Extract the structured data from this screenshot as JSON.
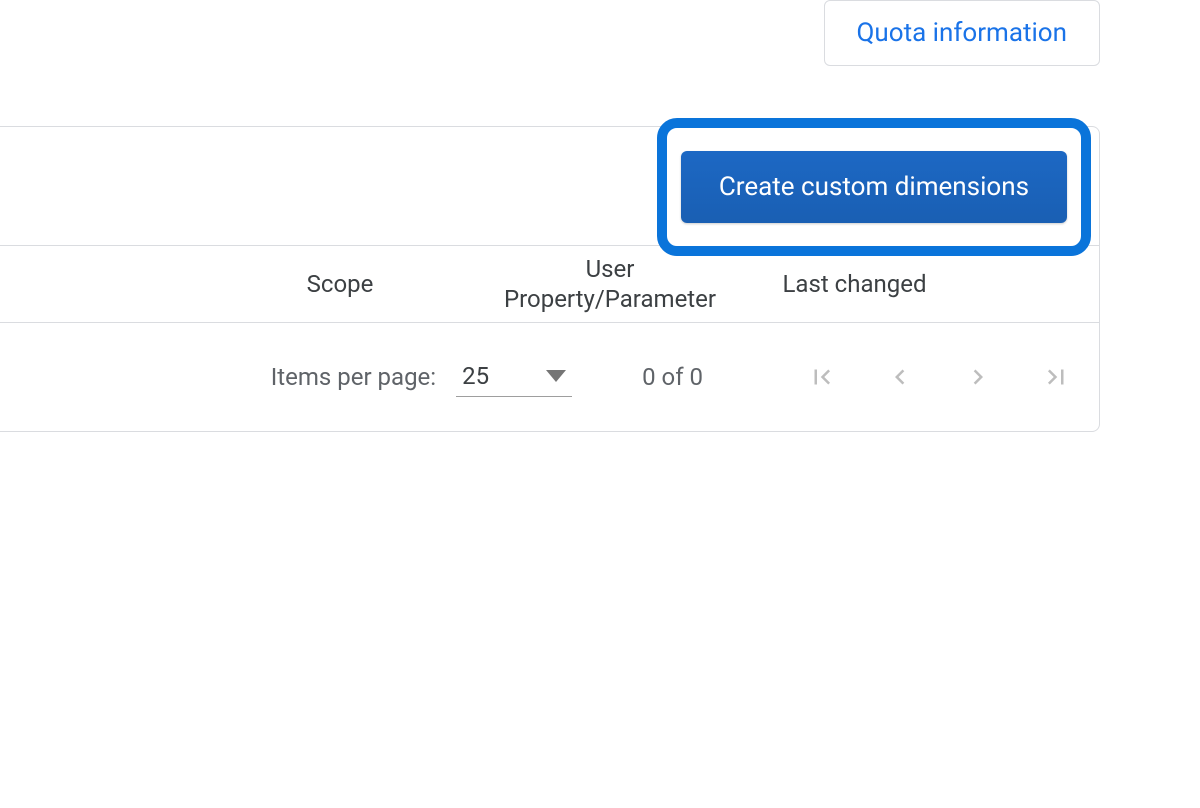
{
  "top": {
    "quota_label": "Quota information"
  },
  "actions": {
    "create_label": "Create custom dimensions"
  },
  "table": {
    "headers": {
      "scope": "Scope",
      "user_property": "User Property/Parameter",
      "last_changed": "Last changed"
    }
  },
  "pagination": {
    "items_per_page_label": "Items per page:",
    "page_size": "25",
    "range_text": "0 of 0"
  }
}
